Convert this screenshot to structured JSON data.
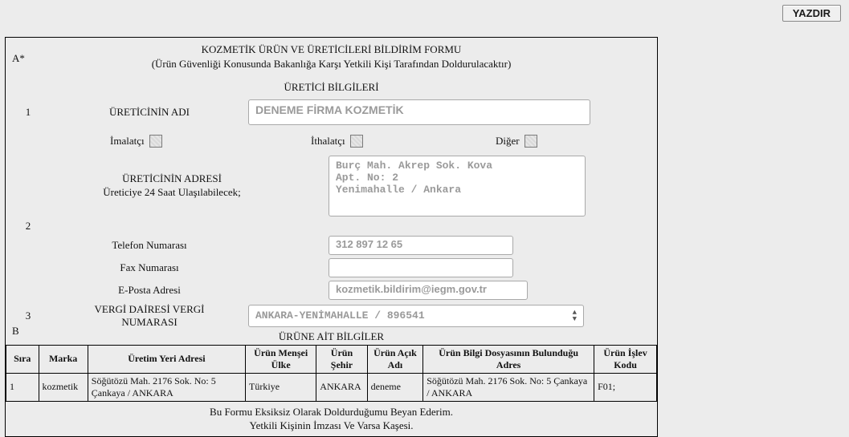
{
  "print_label": "YAZDIR",
  "section_a_marker": "A*",
  "section_b_marker": "B",
  "title_main": "KOZMETİK ÜRÜN VE ÜRETİCİLERİ BİLDİRİM FORMU",
  "title_sub": "(Ürün Güvenliği Konusunda Bakanlığa Karşı Yetkili Kişi Tarafından Doldurulacaktır)",
  "producer_header": "ÜRETİCİ BİLGİLERİ",
  "rows": {
    "r1_num": "1",
    "r1_label": "ÜRETİCİNİN ADI",
    "r1_value": "DENEME FİRMA KOZMETİK",
    "kind_manufacturer": "İmalatçı",
    "kind_importer": "İthalatçı",
    "kind_other": "Diğer",
    "r2_num": "2",
    "addr_label_top": "ÜRETİCİNİN ADRESİ",
    "addr_label_bottom": "Üreticiye 24 Saat Ulaşılabilecek;",
    "addr_value": "Burç Mah. Akrep Sok. Kova\nApt. No: 2\nYenimahalle / Ankara",
    "phone_label": "Telefon Numarası",
    "phone_value": "312 897 12 65",
    "fax_label": "Fax Numarası",
    "fax_value": "",
    "email_label": "E-Posta Adresi",
    "email_value": "kozmetik.bildirim@iegm.gov.tr",
    "r3_num": "3",
    "tax_label_top": "VERGİ DAİRESİ VERGİ",
    "tax_label_bottom": "NUMARASI",
    "tax_value": "ANKARA-YENİMAHALLE / 896541"
  },
  "product_header": "ÜRÜNE AİT BİLGİLER",
  "table": {
    "h_sira": "Sıra",
    "h_marka": "Marka",
    "h_uretim_yeri": "Üretim Yeri Adresi",
    "h_mensei": "Ürün Menşei Ülke",
    "h_sehir": "Ürün Şehir",
    "h_acik": "Ürün Açık Adı",
    "h_dosya": "Ürün Bilgi Dosyasının Bulunduğu Adres",
    "h_islev": "Ürün İşlev Kodu",
    "rows": [
      {
        "sira": "1",
        "marka": "kozmetik",
        "uretim": "Söğütözü Mah. 2176 Sok. No: 5 Çankaya / ANKARA",
        "mensei": "Türkiye",
        "sehir": "ANKARA",
        "acik": "deneme",
        "dosya": "Söğütözü Mah. 2176 Sok. No: 5 Çankaya / ANKARA",
        "islev": "F01;"
      }
    ]
  },
  "footer1": "Bu Formu Eksiksiz Olarak Doldurduğumu Beyan Ederim.",
  "footer2": "Yetkili Kişinin İmzası Ve Varsa Kaşesi."
}
